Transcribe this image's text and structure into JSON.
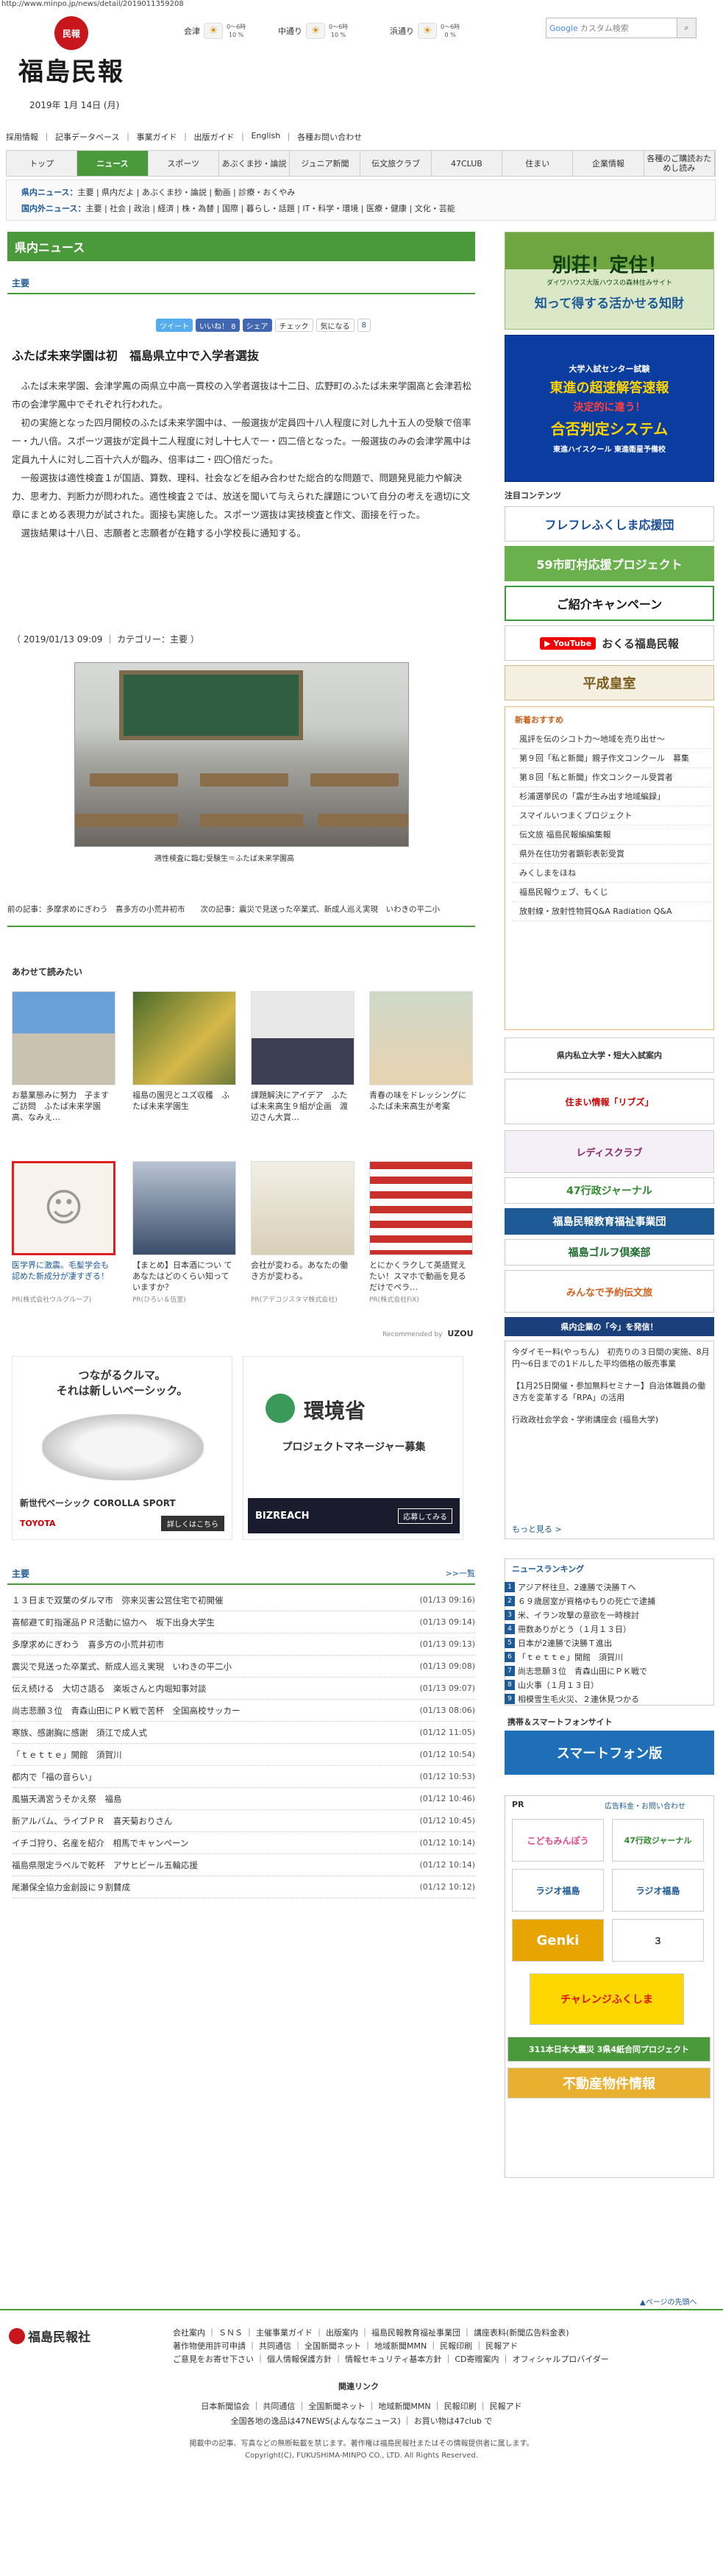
{
  "url": "http://www.minpo.jp/news/detail/2019011359208",
  "header": {
    "logo_seal": "民報",
    "logo_title": "福島民報",
    "date": "2019年 1月 14日 (月)",
    "weather": [
      {
        "area": "会津",
        "icon": "sun-cloud-icon",
        "sym": "☀",
        "l1": "0〜6時",
        "l2": "10 %"
      },
      {
        "area": "中通り",
        "icon": "sun-cloud-icon",
        "sym": "☀",
        "l1": "0〜6時",
        "l2": "10 %"
      },
      {
        "area": "浜通り",
        "icon": "sun-icon",
        "sym": "☀",
        "l1": "0〜6時",
        "l2": "0 %"
      }
    ],
    "search_placeholder": "カスタム検索",
    "search_brand": "Google"
  },
  "top_links": [
    "採用情報",
    "記事データベース",
    "事業ガイド",
    "出版ガイド",
    "English",
    "各種お問い合わせ"
  ],
  "main_nav": [
    {
      "label": "トップ",
      "active": false
    },
    {
      "label": "ニュース",
      "active": true
    },
    {
      "label": "スポーツ",
      "active": false
    },
    {
      "label": "あぶくま抄・論説",
      "active": false
    },
    {
      "label": "ジュニア新聞",
      "active": false
    },
    {
      "label": "伝文旅クラブ",
      "active": false
    },
    {
      "label": "47CLUB",
      "active": false
    },
    {
      "label": "住まい",
      "active": false
    },
    {
      "label": "企業情報",
      "active": false
    },
    {
      "label": "各種のご購読おためし読み",
      "active": false
    }
  ],
  "sub_nav": {
    "row1_head": "県内ニュース：",
    "row1": "主要 | 県内だよ | あぶくま抄・論説 | 動画 | 診療・おくやみ",
    "row2_head": "国内外ニュース：",
    "row2": "主要 | 社会 | 政治 | 経済 | 株・為替 | 国際 | 暮らし・話題 | IT・科学・環境 | 医療・健康 | 文化・芸能"
  },
  "section_title": "県内ニュース",
  "category_tab": "主要",
  "sns": {
    "tweet": "ツイート",
    "like": "いいね！ 8",
    "share": "シェア",
    "check": "チェック",
    "kininaru": "気になる",
    "count": "8"
  },
  "article": {
    "title": "ふたば未来学園は初　福島県立中で入学者選抜",
    "paragraphs": [
      "ふたば未来学園、会津学鳳の両県立中高一貫校の入学者選抜は十二日、広野町のふたば未来学園高と会津若松市の会津学鳳中でそれぞれ行われた。",
      "初の実施となった四月開校のふたば未来学園中は、一般選抜が定員四十八人程度に対し九十五人の受験で倍率一・九八倍。スポーツ選抜が定員十二人程度に対し十七人で一・四二倍となった。一般選抜のみの会津学鳳中は定員九十人に対し二百十六人が臨み、倍率は二・四〇倍だった。",
      "一般選抜は適性検査１が国語、算数、理科、社会などを組み合わせた総合的な問題で、問題発見能力や解決力、思考力、判断力が問われた。適性検査２では、放送を聞いて与えられた課題について自分の考えを適切に文章にまとめる表現力が試された。面接も実施した。スポーツ選抜は実技検査と作文、面接を行った。",
      "選抜結果は十八日、志願者と志願者が在籍する小学校長に通知する。"
    ],
    "meta": "（ 2019/01/13 09:09 ｜ カテゴリー：主要 ）",
    "photo_caption": "適性検査に臨む受験生＝ふたば未来学園高",
    "prev_next": "前の記事：多摩求めにぎわう　喜多方の小荒井初市　　次の記事：震災で見送った卒業式、新成人巡え実現　いわきの平二小"
  },
  "related": {
    "title": "あわせて読みたい",
    "items": [
      {
        "text": "お墓業態みに努力　子ますご訪問　ふたば未来学園高、なみえ…"
      },
      {
        "text": "福島の園児とユズ収穫　ふたば未来学園生"
      },
      {
        "text": "課題解決にアイデア　ふたば未来高生９組が企画　渡辺さん大賞…"
      },
      {
        "text": "青春の味をドレッシングに　ふたば未来高生が考案"
      },
      {
        "text": "医学界に激震。毛髪学会も認めた新成分が凄すぎる！",
        "pr": "PR(株式会社ウルグループ)"
      },
      {
        "text": "【まとめ】日本酒につい てあなたはどのくらい知っていますか？",
        "pr": "PR(ひろい＆伍室)"
      },
      {
        "text": "会社が変わる。あなたの働き方が変わる。",
        "pr": "PR(アデコジスタマ株式会社)"
      },
      {
        "text": "とにかくラクして英語覚えたい！スマホで動画を見るだけでペラ…",
        "pr": "PR(株式会社FiX)"
      }
    ],
    "recommended": "Recommended by",
    "uzou": "UZOU"
  },
  "ads": {
    "toyota_line1": "つながるクルマ。",
    "toyota_line2": "それは新しいベーシック。",
    "toyota_car": "新世代ベーシック COROLLA SPORT",
    "toyota_brand": "TOYOTA",
    "toyota_btn": "詳しくはこちら",
    "env_title": "環境省",
    "env_sub": "プロジェクトマネージャー募集",
    "env_brand": "BIZREACH",
    "env_btn": "応募してみる"
  },
  "main_list": {
    "head": "主要",
    "more": ">>一覧",
    "rows": [
      {
        "t": "１３日まで双葉のダルマ市　弥来災害公営住宅で初開催",
        "d": "(01/13 09:16)"
      },
      {
        "t": "喜郁避て町指運品ＰＲ活動に協力へ　坂下出身大学生",
        "d": "(01/13 09:14)"
      },
      {
        "t": "多摩求めにぎわう　喜多方の小荒井初市",
        "d": "(01/13 09:13)"
      },
      {
        "t": "震災で見送った卒業式、新成人巡え実現　いわきの平二小",
        "d": "(01/13 09:08)"
      },
      {
        "t": "伝え続ける　大切さ語る　楽坂さんと内堀知事対談",
        "d": "(01/13 09:07)"
      },
      {
        "t": "尚志悲願３位　青森山田にＰＫ戦で苦杯　全国高校サッカー",
        "d": "(01/13 08:06)"
      },
      {
        "t": "寒族、感謝胸に感謝　須江で成人式",
        "d": "(01/12 11:05)"
      },
      {
        "t": "「ｔｅｔｔｅ」開館　須賀川",
        "d": "(01/12 10:54)"
      },
      {
        "t": "都内で「福の音らい」",
        "d": "(01/12 10:53)"
      },
      {
        "t": "風猫天満宮うそかえ祭　福島",
        "d": "(01/12 10:46)"
      },
      {
        "t": "新アルバム、ライブＰＲ　喜天菊おりさん",
        "d": "(01/12 10:45)"
      },
      {
        "t": "イチゴ狩り、名産を紹介　相馬でキャンペーン",
        "d": "(01/12 10:14)"
      },
      {
        "t": "福島県限定ラベルで乾杯　アサヒビール五輪応援",
        "d": "(01/12 10:14)"
      },
      {
        "t": "尾瀬保全協力金創設に９割賛成",
        "d": "(01/12 10:12)"
      }
    ]
  },
  "sidebar": {
    "ad1_top": "別荘！定住！",
    "ad1_brand": "ダイワハウス大阪ハウスの森林住みサイト",
    "ad1_bottom": "知って得する活かせる知財",
    "ad2_top": "大学入試センター試験",
    "ad2_mid": "東進の超速解答速報",
    "ad2_mid2": "決定的に違う！",
    "ad2_low": "合否判定システム",
    "ad2_bot": "東進ハイスクール 東進衛星予備校",
    "contents_head": "注目コンテンツ",
    "furefure": "フレフレふくしま応援団",
    "shichoson": "59市町村応援プロジェクト",
    "shokai": "ご紹介キャンペーン",
    "youtube": "おくる福島民報",
    "heisei": "平成皇室",
    "news_head": "新着おすすめ",
    "news_items": [
      "風評を伝のシコト力～地域を売り出せ～",
      "第９回「私と新聞」親子作文コンクール　募集",
      "第８回「私と新聞」作文コンクール受賞者",
      "杉浦選挙民の「震が生み出す地域編録」",
      "スマイルいつまくプロジェクト",
      "伝文旅 福島民報編編集報",
      "県外在住功労者顕彰表彰受賞",
      "みくしまをほね",
      "福島民報ウェブ、もくじ",
      "放射線・放射性物質Q&A Radiation Q&A"
    ],
    "univ": "県内私立大学・短大入試案内",
    "lives": "住まい情報「リブズ」",
    "ladies": "レディスクラブ",
    "club47": "47行政ジャーナル",
    "kyoiku": "福島民報教育福祉事業団",
    "golf": "福島ゴルフ倶楽部",
    "salon": "みんなで予約伝文旅",
    "kigyo": "県内企業の「今」を発信！",
    "news_head2": "新着",
    "news_extra": [
      "今ダイモー料(やっちん)　初売りの３日間の実施、8月円～6日までの1ドルした平均価格の販売事業",
      "【1月25日開催・参加無料セミナー】自治体職員の働き方を変革する「RPA」の活用",
      "行政政社会学会・学術講座会 (福島大学)"
    ],
    "news_more": "もっと見る >",
    "rank_head": "ニュースランキング",
    "ranking": [
      "アジア杯往旦、2連勝で決勝Ｔへ",
      "６９歳居室が資格ゆもりの死亡で逮捕",
      "米、イラン攻撃の意欲を一時検討",
      "冊数ありがとう（１月１３日）",
      "日本が2連勝で決勝Ｔ進出",
      "「ｔｅｔｔｅ」開館　須賀川",
      "尚志悲願３位　青森山田にＰＫ戦で",
      "山火事（１月１３日）",
      "相模雪生毛火災、２連休見つかる"
    ],
    "mobile_head": "携帯＆スマートフォンサイト",
    "mobile_banner": "スマートフォン版",
    "pr_head": "PR",
    "pr_links": "広告料金・お問い合わせ",
    "kodomo": "こどもみんぽう",
    "rfc": "ラジオ福島",
    "genki": "Genki",
    "challenge": "チャレンジふくしま",
    "project": "311本日本大震災 3県4紙合同プロジェクト",
    "fudosan": "不動産物件情報"
  },
  "footer": {
    "pagetop": "▲ページの先頭へ",
    "logo": "福島民報社",
    "row1": "会社案内 ｜ ＳＮＳ ｜ 主催事業ガイド ｜ 出版案内 ｜ 福島民報教育福祉事業団 ｜ 講座表料(新聞広告料金表)",
    "row2": "著作物使用許可申請 ｜ 共同通信 ｜ 全国新聞ネット ｜ 地域新聞MMN ｜ 民報印刷 ｜ 民報アド",
    "row3": "ご意見をお寄せ下さい ｜ 個人情報保護方針 ｜ 情報セキュリティ基本方針 ｜ CD寄贈案内 ｜ オフィシャルプロバイダー",
    "related_head": "関連リンク",
    "related1": "日本新聞協会 ｜ 共同通信 ｜ 全国新聞ネット ｜ 地域新聞MMN ｜ 民報印刷 ｜ 民報アド",
    "related2": "全国各地の逸品は47NEWS(よんななニュース) ｜ お買い物は47club で",
    "notice": "掲載中の記事、写真などの無断転載を禁じます。著作権は福島民報社またはその情報提供者に属します。",
    "copyright": "Copyright(C), FUKUSHIMA-MINPO CO., LTD. All Rights Reserved."
  }
}
